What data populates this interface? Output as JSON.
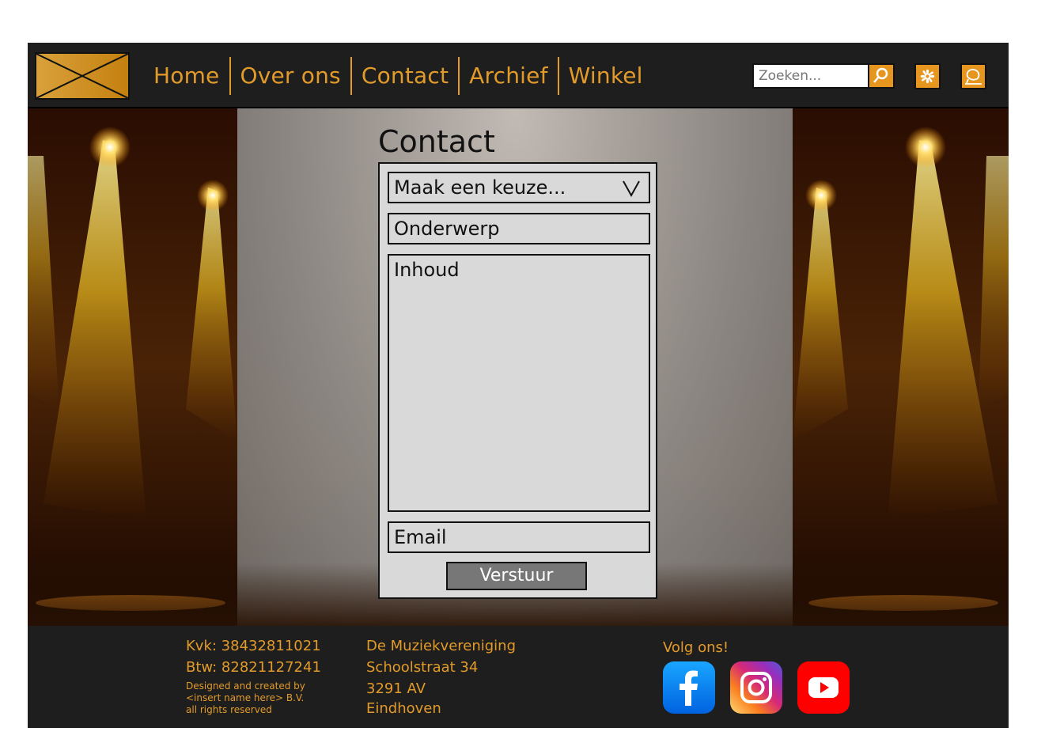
{
  "nav": {
    "items": [
      "Home",
      "Over ons",
      "Contact",
      "Archief",
      "Winkel"
    ]
  },
  "search": {
    "placeholder": "Zoeken..."
  },
  "header_icons": [
    "search-icon",
    "flower-icon",
    "speech-bubble-icon"
  ],
  "page": {
    "title": "Contact"
  },
  "form": {
    "select_value": "Maak een keuze...",
    "subject_placeholder": "Onderwerp",
    "content_placeholder": "Inhoud",
    "email_placeholder": "Email",
    "submit_label": "Verstuur"
  },
  "footer": {
    "kvk": "Kvk: 38432811021",
    "btw": "Btw: 82821127241",
    "credit_line1": "Designed and created by",
    "credit_line2": "<insert name here> B.V.",
    "credit_line3": "all rights reserved",
    "org_name": "De Muziekvereniging",
    "street": "Schoolstraat 34",
    "postcode": "3291 AV",
    "city": "Eindhoven",
    "follow": "Volg ons!",
    "socials": [
      "facebook-icon",
      "instagram-icon",
      "youtube-icon"
    ]
  },
  "colors": {
    "accent": "#e29b2a",
    "header_bg": "#1e1e1e",
    "form_bg": "#d9d9d9",
    "submit_bg": "#777777"
  }
}
